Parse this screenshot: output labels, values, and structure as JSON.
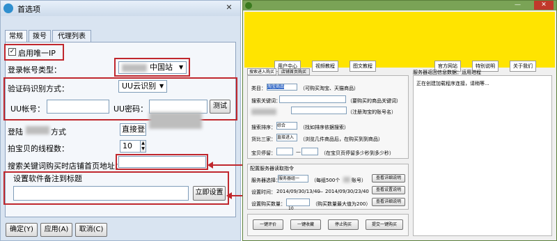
{
  "dialog": {
    "title": "首选项",
    "close_glyph": "✕",
    "tabs": [
      "常规",
      "拨号",
      "代理列表"
    ],
    "unique_ip_label": "启用唯一IP",
    "unique_ip_checked": true,
    "account_type_label": "登录帐号类型：",
    "account_type_value": "中国站",
    "captcha_label": "验证码识别方式：",
    "captcha_value": "UU云识别",
    "uu_account_label": "UU帐号：",
    "uu_password_label": "UU密码：",
    "test_button": "测试",
    "login_mode_label_a": "登陆",
    "login_mode_label_b": "方式",
    "login_mode_value": "直接登陆",
    "threads_label": "拍宝贝的线程数：",
    "threads_value": "10",
    "search_url_label": "搜索关键词购买时店铺首页地址：",
    "remark_label": "设置软件备注到标题",
    "apply_now_button": "立即设置",
    "ok_button": "确定(Y)",
    "apply_button": "应用(A)",
    "cancel_button": "取消(C)"
  },
  "app": {
    "nav": [
      "用户中心",
      "视频教程",
      "图文教程",
      "官方网站",
      "特别说明",
      "关于我们"
    ],
    "tabs": [
      "搜索进入购买",
      "店铺首页购买"
    ],
    "category_label": "类目：",
    "category_value": "淘宝商品",
    "category_hint": "（可购买淘宝、天猫商品）",
    "keyword_label": "搜索关键词：",
    "keyword_hint": "（要购买的商品关键词）",
    "account_hint": "（注册淘宝的账号名）",
    "sort_label": "搜索排序：",
    "sort_value": "综合",
    "sort_hint": "（找如排序依据搜索）",
    "compare_label": "货比三家：",
    "compare_value": "直接进入",
    "compare_hint": "（浏览几件商品后，在购买到到商品）",
    "stay_label": "宝贝停留：",
    "stay_sep": "—",
    "stay_hint": "（在宝贝页停留多少秒到多少秒）",
    "server_group": "配置服务器读取指令",
    "server_select_label": "服务器选择：",
    "server_select_value": "服务器组一",
    "server_hint": "（每组500个",
    "server_hint2": "账号）",
    "view_details": "查看详细说明",
    "set_time_label": "设置时间：",
    "time_start": "2014/09/30/13/40",
    "time_sep": "—",
    "time_end": "2014/09/30/23/40",
    "view_settings": "查看设置说明",
    "buy_count_label": "设置购买数量：",
    "buy_count_value": "10",
    "buy_count_hint": "（购买数量最大值为200）",
    "action_buttons": [
      "一键评价",
      "一键收藏",
      "停止购买",
      "提交一键购买"
    ],
    "log_title": "服务器返回信息数据：运用进程",
    "log_text": "正在创建加载程序连接，请稍等..."
  }
}
